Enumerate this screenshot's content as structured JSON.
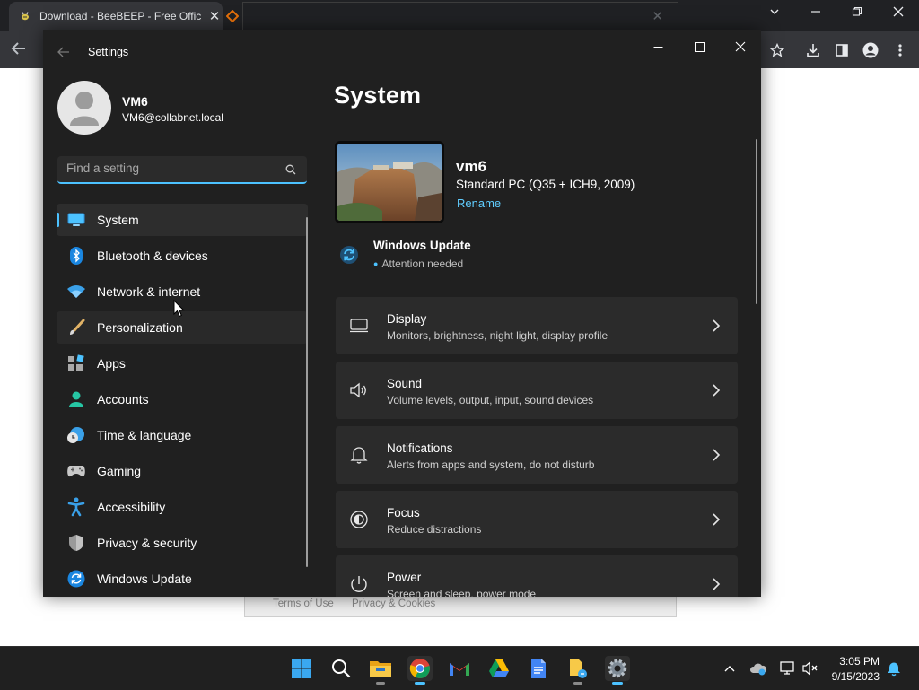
{
  "browser": {
    "tab1_title": "Download - BeeBEEP - Free Offic",
    "tab1_close": "✕",
    "footer_links": [
      "Terms of Use",
      "Privacy & Cookies"
    ]
  },
  "settings": {
    "window_title": "Settings",
    "user": {
      "name": "VM6",
      "email": "VM6@collabnet.local"
    },
    "search": {
      "placeholder": "Find a setting"
    },
    "nav": [
      {
        "label": "System",
        "icon": "monitor-icon",
        "selected": true
      },
      {
        "label": "Bluetooth & devices",
        "icon": "bluetooth-icon"
      },
      {
        "label": "Network & internet",
        "icon": "wifi-icon"
      },
      {
        "label": "Personalization",
        "icon": "brush-icon"
      },
      {
        "label": "Apps",
        "icon": "apps-icon"
      },
      {
        "label": "Accounts",
        "icon": "person-icon"
      },
      {
        "label": "Time & language",
        "icon": "clock-globe-icon"
      },
      {
        "label": "Gaming",
        "icon": "gamepad-icon"
      },
      {
        "label": "Accessibility",
        "icon": "accessibility-icon"
      },
      {
        "label": "Privacy & security",
        "icon": "shield-icon"
      },
      {
        "label": "Windows Update",
        "icon": "update-icon"
      }
    ],
    "main": {
      "title": "System",
      "device": {
        "name": "vm6",
        "model": "Standard PC (Q35 + ICH9, 2009)",
        "rename": "Rename"
      },
      "windows_update": {
        "title": "Windows Update",
        "status": "Attention needed"
      },
      "cards": [
        {
          "title": "Display",
          "subtitle": "Monitors, brightness, night light, display profile",
          "icon": "display-icon"
        },
        {
          "title": "Sound",
          "subtitle": "Volume levels, output, input, sound devices",
          "icon": "speaker-icon"
        },
        {
          "title": "Notifications",
          "subtitle": "Alerts from apps and system, do not disturb",
          "icon": "bell-icon"
        },
        {
          "title": "Focus",
          "subtitle": "Reduce distractions",
          "icon": "focus-icon"
        },
        {
          "title": "Power",
          "subtitle": "Screen and sleep, power mode",
          "icon": "power-icon"
        }
      ]
    }
  },
  "taskbar": {
    "apps": [
      "start-icon",
      "search-icon",
      "file-explorer-icon",
      "chrome-icon",
      "gmail-icon",
      "google-drive-icon",
      "google-docs-icon",
      "folder-app-icon",
      "settings-icon"
    ],
    "clock": {
      "time": "3:05 PM",
      "date": "9/15/2023"
    }
  },
  "colors": {
    "accent": "#4cc2ff",
    "link": "#60cdff",
    "window_bg": "#202020",
    "card_bg": "#2b2b2b"
  }
}
